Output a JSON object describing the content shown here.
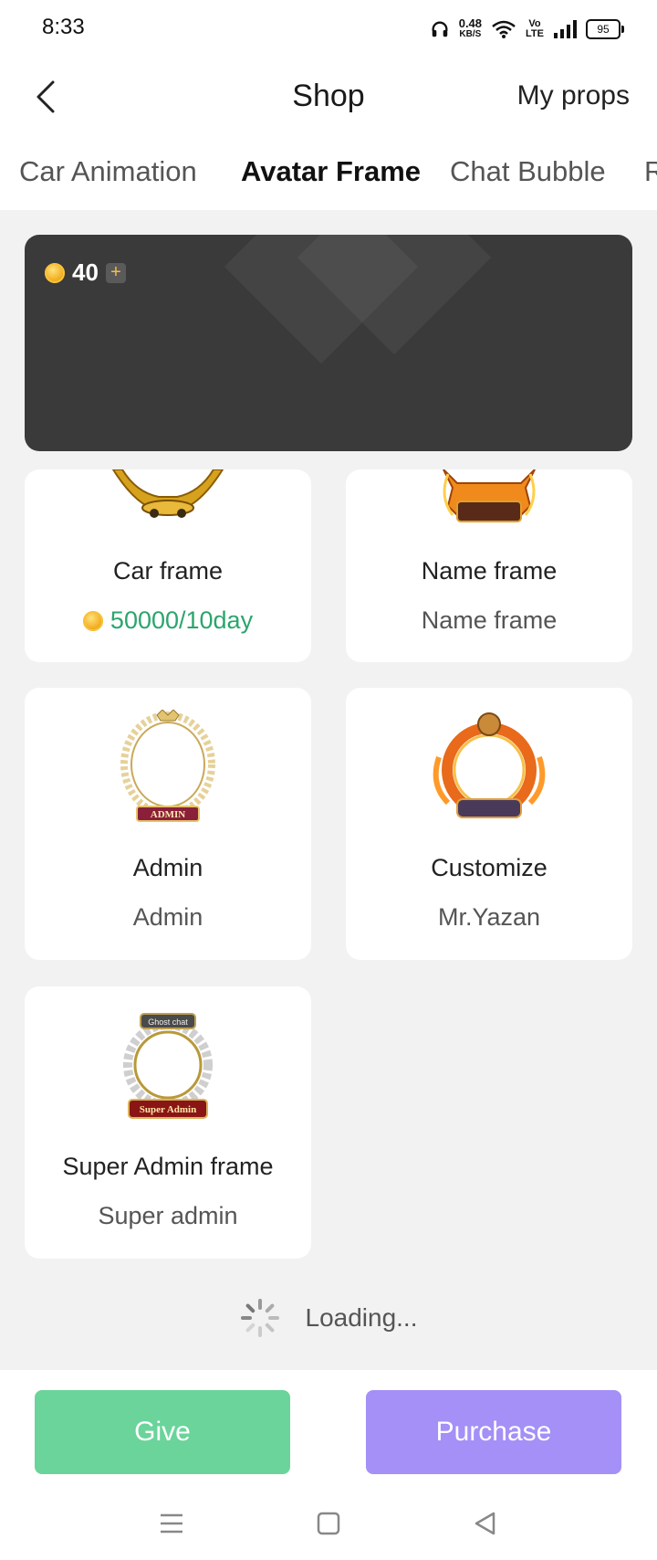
{
  "status_bar": {
    "time": "8:33",
    "net_speed": "0.48",
    "net_unit": "KB/S",
    "volte_top": "Vo",
    "volte_bottom": "LTE",
    "battery": "95"
  },
  "header": {
    "title": "Shop",
    "right_link": "My props",
    "back_icon": "chevron-left-icon"
  },
  "tabs": [
    {
      "label": "Car Animation",
      "active": false
    },
    {
      "label": "Avatar Frame",
      "active": true
    },
    {
      "label": "Chat Bubble",
      "active": false
    },
    {
      "label": "R",
      "active": false
    }
  ],
  "wallet": {
    "coins": "40",
    "coin_icon": "coin-icon",
    "add_icon": "plus-icon"
  },
  "items": [
    {
      "name": "Car frame",
      "price": "50000/10day",
      "subtitle": null
    },
    {
      "name": "Name frame",
      "subtitle": "Name frame"
    },
    {
      "name": "Admin",
      "subtitle": "Admin",
      "badge": "ADMIN"
    },
    {
      "name": "Customize",
      "subtitle": "Mr.Yazan"
    },
    {
      "name": "Super Admin frame",
      "subtitle": "Super admin",
      "badge": "Super Admin",
      "badge_top": "Ghost chat"
    }
  ],
  "loading": {
    "text": "Loading..."
  },
  "actions": {
    "give": "Give",
    "purchase": "Purchase"
  },
  "colors": {
    "give": "#6ad49a",
    "purchase": "#a490f7",
    "price": "#2ba56c",
    "wallet_bg": "#3a3a3a"
  }
}
